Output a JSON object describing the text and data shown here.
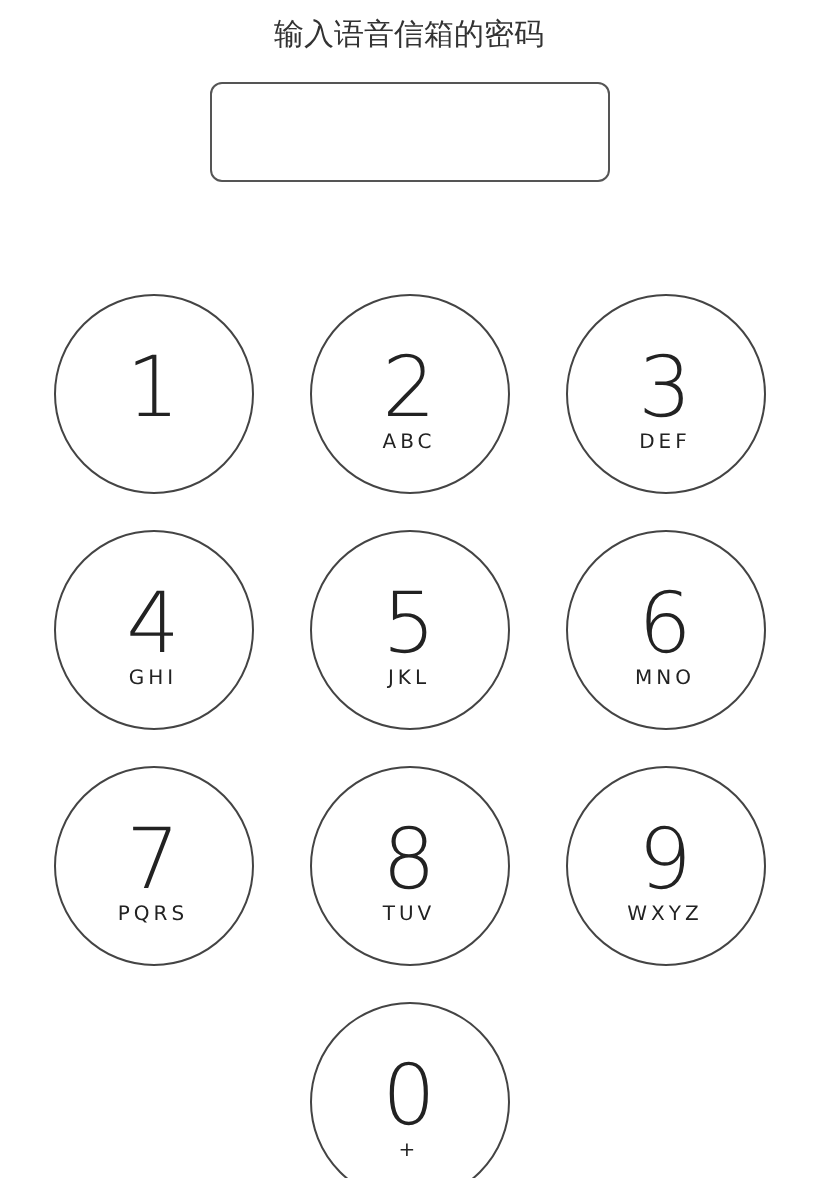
{
  "title": "输入语音信箱的密码",
  "keys": [
    {
      "digit": "1"
    },
    {
      "digit": "2",
      "letters": "ABC"
    },
    {
      "digit": "3",
      "letters": "DEF"
    },
    {
      "digit": "4",
      "letters": "GHI"
    },
    {
      "digit": "5",
      "letters": "JKL"
    },
    {
      "digit": "6",
      "letters": "MNO"
    },
    {
      "digit": "7",
      "letters": "PQRS"
    },
    {
      "digit": "8",
      "letters": "TUV"
    },
    {
      "digit": "9",
      "letters": "WXYZ"
    },
    {
      "digit": "0",
      "letters": "+"
    }
  ]
}
